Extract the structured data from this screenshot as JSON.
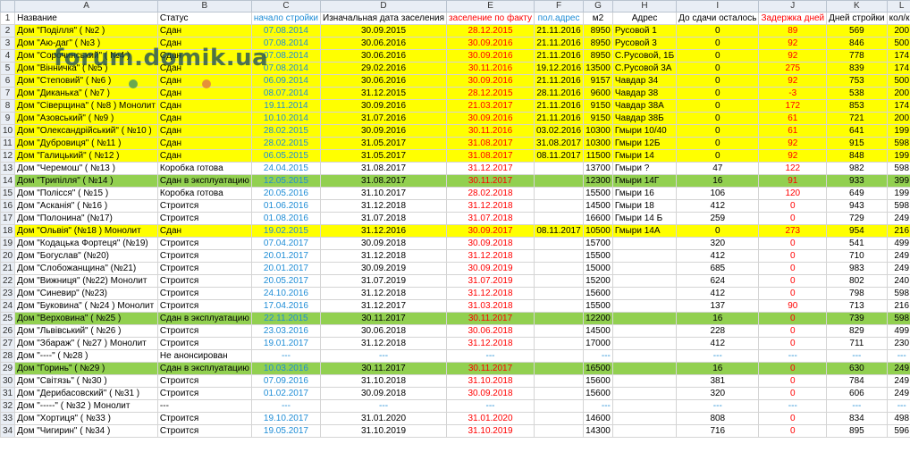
{
  "columns": [
    "A",
    "B",
    "C",
    "D",
    "E",
    "F",
    "G",
    "H",
    "I",
    "J",
    "K",
    "L"
  ],
  "header": [
    "Название",
    "Статус",
    "начало стройки",
    "Изначальная дата заселения",
    "заселение по факту",
    "пол.адрес",
    "м2",
    "Адрес",
    "До сдачи осталось",
    "Задержка дней",
    "Дней стройки",
    "кол/кв"
  ],
  "watermark": "forum.domik.ua",
  "colors": {
    "yellow": "#ffff00",
    "green": "#92d050",
    "blue": "#1f8dd6",
    "red": "#ff0000",
    "dot_green": "#6aa84f",
    "dot_orange": "#e69138"
  },
  "rows": [
    {
      "n": "2",
      "fill": "yellow",
      "cells": [
        "Дом \"Поділля\" ( №2 )",
        "Сдан",
        "07.08.2014",
        "30.09.2015",
        "28.12.2015",
        "21.11.2016",
        "8950",
        "Русовой 1",
        "0",
        "89",
        "569",
        "200"
      ]
    },
    {
      "n": "3",
      "fill": "yellow",
      "cells": [
        "Дом \"Аю-даг\" ( №3 )",
        "Сдан",
        "07.08.2014",
        "30.06.2016",
        "30.09.2016",
        "21.11.2016",
        "8950",
        "Русовой 3",
        "0",
        "92",
        "846",
        "500"
      ]
    },
    {
      "n": "4",
      "fill": "yellow",
      "cells": [
        "Дом \"Сорочинський\" ( №4 )",
        "Сдан",
        "07.08.2014",
        "30.06.2016",
        "30.09.2016",
        "21.11.2016",
        "8950",
        "С.Русовой, 1Б",
        "0",
        "92",
        "778",
        "174"
      ]
    },
    {
      "n": "5",
      "fill": "yellow",
      "cells": [
        "Дом \"Вінничка\" ( №5 )",
        "Сдан",
        "07.08.2014",
        "29.02.2016",
        "30.11.2016",
        "19.12.2016",
        "13500",
        "С.Русовой 3А",
        "0",
        "275",
        "839",
        "174"
      ]
    },
    {
      "n": "6",
      "fill": "yellow",
      "cells": [
        "Дом \"Степовий\" ( №6 )",
        "Сдан",
        "06.09.2014",
        "30.06.2016",
        "30.09.2016",
        "21.11.2016",
        "9157",
        "Чавдар 34",
        "0",
        "92",
        "753",
        "500"
      ]
    },
    {
      "n": "7",
      "fill": "yellow",
      "cells": [
        "Дом \"Диканька\" ( №7 )",
        "Сдан",
        "08.07.2014",
        "31.12.2015",
        "28.12.2015",
        "28.11.2016",
        "9600",
        "Чавдар 38",
        "0",
        "-3",
        "538",
        "200"
      ]
    },
    {
      "n": "8",
      "fill": "yellow",
      "cells": [
        "Дом \"Сіверщина\" ( №8 ) Монолит",
        "Сдан",
        "19.11.2014",
        "30.09.2016",
        "21.03.2017",
        "21.11.2016",
        "9150",
        "Чавдар 38А",
        "0",
        "172",
        "853",
        "174"
      ]
    },
    {
      "n": "9",
      "fill": "yellow",
      "cells": [
        "Дом \"Азовський\" ( №9 )",
        "Сдан",
        "10.10.2014",
        "31.07.2016",
        "30.09.2016",
        "21.11.2016",
        "9150",
        "Чавдар 38Б",
        "0",
        "61",
        "721",
        "200"
      ]
    },
    {
      "n": "10",
      "fill": "yellow",
      "cells": [
        "Дом \"Олександрійський\" ( №10 )",
        "Сдан",
        "28.02.2015",
        "30.09.2016",
        "30.11.2016",
        "03.02.2016",
        "10300",
        "Гмыри 10/40",
        "0",
        "61",
        "641",
        "199"
      ]
    },
    {
      "n": "11",
      "fill": "yellow",
      "cells": [
        "Дом \"Дубровиця\" ( №11 )",
        "Сдан",
        "28.02.2015",
        "31.05.2017",
        "31.08.2017",
        "31.08.2017",
        "10300",
        "Гмыри 12Б",
        "0",
        "92",
        "915",
        "598"
      ]
    },
    {
      "n": "12",
      "fill": "yellow",
      "cells": [
        "Дом \"Галицький\" ( №12 )",
        "Сдан",
        "06.05.2015",
        "31.05.2017",
        "31.08.2017",
        "08.11.2017",
        "11500",
        "Гмыри 14",
        "0",
        "92",
        "848",
        "199"
      ]
    },
    {
      "n": "13",
      "fill": "none",
      "cells": [
        "Дом \"Черемош\" ( №13 )",
        "Коробка готова",
        "24.04.2015",
        "31.08.2017",
        "31.12.2017",
        "",
        "13700",
        "Гмыри ?",
        "47",
        "122",
        "982",
        "598"
      ]
    },
    {
      "n": "14",
      "fill": "green",
      "cells": [
        "Дом \"Трипілля\" ( №14 )",
        "Сдан в эксплуатацию",
        "12.05.2015",
        "31.08.2017",
        "30.11.2017",
        "",
        "12300",
        "Гмыри 14Г",
        "16",
        "91",
        "933",
        "399"
      ]
    },
    {
      "n": "15",
      "fill": "none",
      "cells": [
        "Дом \"Полісся\" ( №15 )",
        "Коробка готова",
        "20.05.2016",
        "31.10.2017",
        "28.02.2018",
        "",
        "15500",
        "Гмыри 16",
        "106",
        "120",
        "649",
        "199"
      ]
    },
    {
      "n": "16",
      "fill": "none",
      "cells": [
        "Дом \"Асканія\" ( №16 )",
        "Строится",
        "01.06.2016",
        "31.12.2018",
        "31.12.2018",
        "",
        "14500",
        "Гмыри 18",
        "412",
        "0",
        "943",
        "598"
      ]
    },
    {
      "n": "17",
      "fill": "none",
      "cells": [
        "Дом \"Полонина\" (№17)",
        "Строится",
        "01.08.2016",
        "31.07.2018",
        "31.07.2018",
        "",
        "16600",
        "Гмыри 14 Б",
        "259",
        "0",
        "729",
        "249"
      ]
    },
    {
      "n": "18",
      "fill": "yellow",
      "cells": [
        "Дом \"Ольвія\" (№18 ) Монолит",
        "Сдан",
        "19.02.2015",
        "31.12.2016",
        "30.09.2017",
        "08.11.2017",
        "10500",
        "Гмыри 14А",
        "0",
        "273",
        "954",
        "216"
      ]
    },
    {
      "n": "19",
      "fill": "none",
      "cells": [
        "Дом \"Кодацька Фортеця\" (№19)",
        "Строится",
        "07.04.2017",
        "30.09.2018",
        "30.09.2018",
        "",
        "15700",
        "",
        "320",
        "0",
        "541",
        "499"
      ]
    },
    {
      "n": "20",
      "fill": "none",
      "cells": [
        "Дом \"Богуслав\" (№20)",
        "Строится",
        "20.01.2017",
        "31.12.2018",
        "31.12.2018",
        "",
        "15500",
        "",
        "412",
        "0",
        "710",
        "249"
      ]
    },
    {
      "n": "21",
      "fill": "none",
      "cells": [
        "Дом \"Слобожанщина\" (№21)",
        "Строится",
        "20.01.2017",
        "30.09.2019",
        "30.09.2019",
        "",
        "15000",
        "",
        "685",
        "0",
        "983",
        "249"
      ]
    },
    {
      "n": "22",
      "fill": "none",
      "cells": [
        "Дом \"Вижниця\" (№22) Монолит",
        "Строится",
        "20.05.2017",
        "31.07.2019",
        "31.07.2019",
        "",
        "15200",
        "",
        "624",
        "0",
        "802",
        "240"
      ]
    },
    {
      "n": "23",
      "fill": "none",
      "cells": [
        "Дом \"Синевир\" (№23)",
        "Строится",
        "24.10.2016",
        "31.12.2018",
        "31.12.2018",
        "",
        "15600",
        "",
        "412",
        "0",
        "798",
        "598"
      ]
    },
    {
      "n": "24",
      "fill": "none",
      "cells": [
        "Дом \"Буковина\" ( №24 ) Монолит",
        "Строится",
        "17.04.2016",
        "31.12.2017",
        "31.03.2018",
        "",
        "15500",
        "",
        "137",
        "90",
        "713",
        "216"
      ]
    },
    {
      "n": "25",
      "fill": "green",
      "cells": [
        "Дом \"Верховина\" ( №25 )",
        "Сдан в эксплуатацию",
        "22.11.2015",
        "30.11.2017",
        "30.11.2017",
        "",
        "12200",
        "",
        "16",
        "0",
        "739",
        "598"
      ]
    },
    {
      "n": "26",
      "fill": "none",
      "cells": [
        "Дом \"Львівський\" ( №26 )",
        "Строится",
        "23.03.2016",
        "30.06.2018",
        "30.06.2018",
        "",
        "14500",
        "",
        "228",
        "0",
        "829",
        "499"
      ]
    },
    {
      "n": "27",
      "fill": "none",
      "cells": [
        "Дом \"Збараж\" ( №27 ) Монолит",
        "Строится",
        "19.01.2017",
        "31.12.2018",
        "31.12.2018",
        "",
        "17000",
        "",
        "412",
        "0",
        "711",
        "230"
      ]
    },
    {
      "n": "28",
      "fill": "none",
      "cells": [
        "Дом \"----\" ( №28 )",
        "Не анонсирован",
        "---",
        "---",
        "---",
        "",
        "---",
        "",
        "---",
        "---",
        "---",
        "---"
      ]
    },
    {
      "n": "29",
      "fill": "green",
      "cells": [
        "Дом \"Горинь\" ( №29 )",
        "Сдан в эксплуатацию",
        "10.03.2016",
        "30.11.2017",
        "30.11.2017",
        "",
        "16500",
        "",
        "16",
        "0",
        "630",
        "249"
      ]
    },
    {
      "n": "30",
      "fill": "none",
      "cells": [
        "Дом \"Світязь\" ( №30 )",
        "Строится",
        "07.09.2016",
        "31.10.2018",
        "31.10.2018",
        "",
        "15600",
        "",
        "381",
        "0",
        "784",
        "249"
      ]
    },
    {
      "n": "31",
      "fill": "none",
      "cells": [
        "Дом \"Дерибасовский\" ( №31 )",
        "Строится",
        "01.02.2017",
        "30.09.2018",
        "30.09.2018",
        "",
        "15600",
        "",
        "320",
        "0",
        "606",
        "249"
      ]
    },
    {
      "n": "32",
      "fill": "none",
      "cells": [
        "Дом \"-----\" ( №32 ) Монолит",
        "---",
        "---",
        "---",
        "---",
        "",
        "---",
        "",
        "---",
        "---",
        "---",
        "---"
      ]
    },
    {
      "n": "33",
      "fill": "none",
      "cells": [
        "Дом \"Хортиця\" ( №33 )",
        "Строится",
        "19.10.2017",
        "31.01.2020",
        "31.01.2020",
        "",
        "14600",
        "",
        "808",
        "0",
        "834",
        "498"
      ]
    },
    {
      "n": "34",
      "fill": "none",
      "cells": [
        "Дом \"Чигирин\" ( №34 )",
        "Строится",
        "19.05.2017",
        "31.10.2019",
        "31.10.2019",
        "",
        "14300",
        "",
        "716",
        "0",
        "895",
        "596"
      ]
    }
  ]
}
